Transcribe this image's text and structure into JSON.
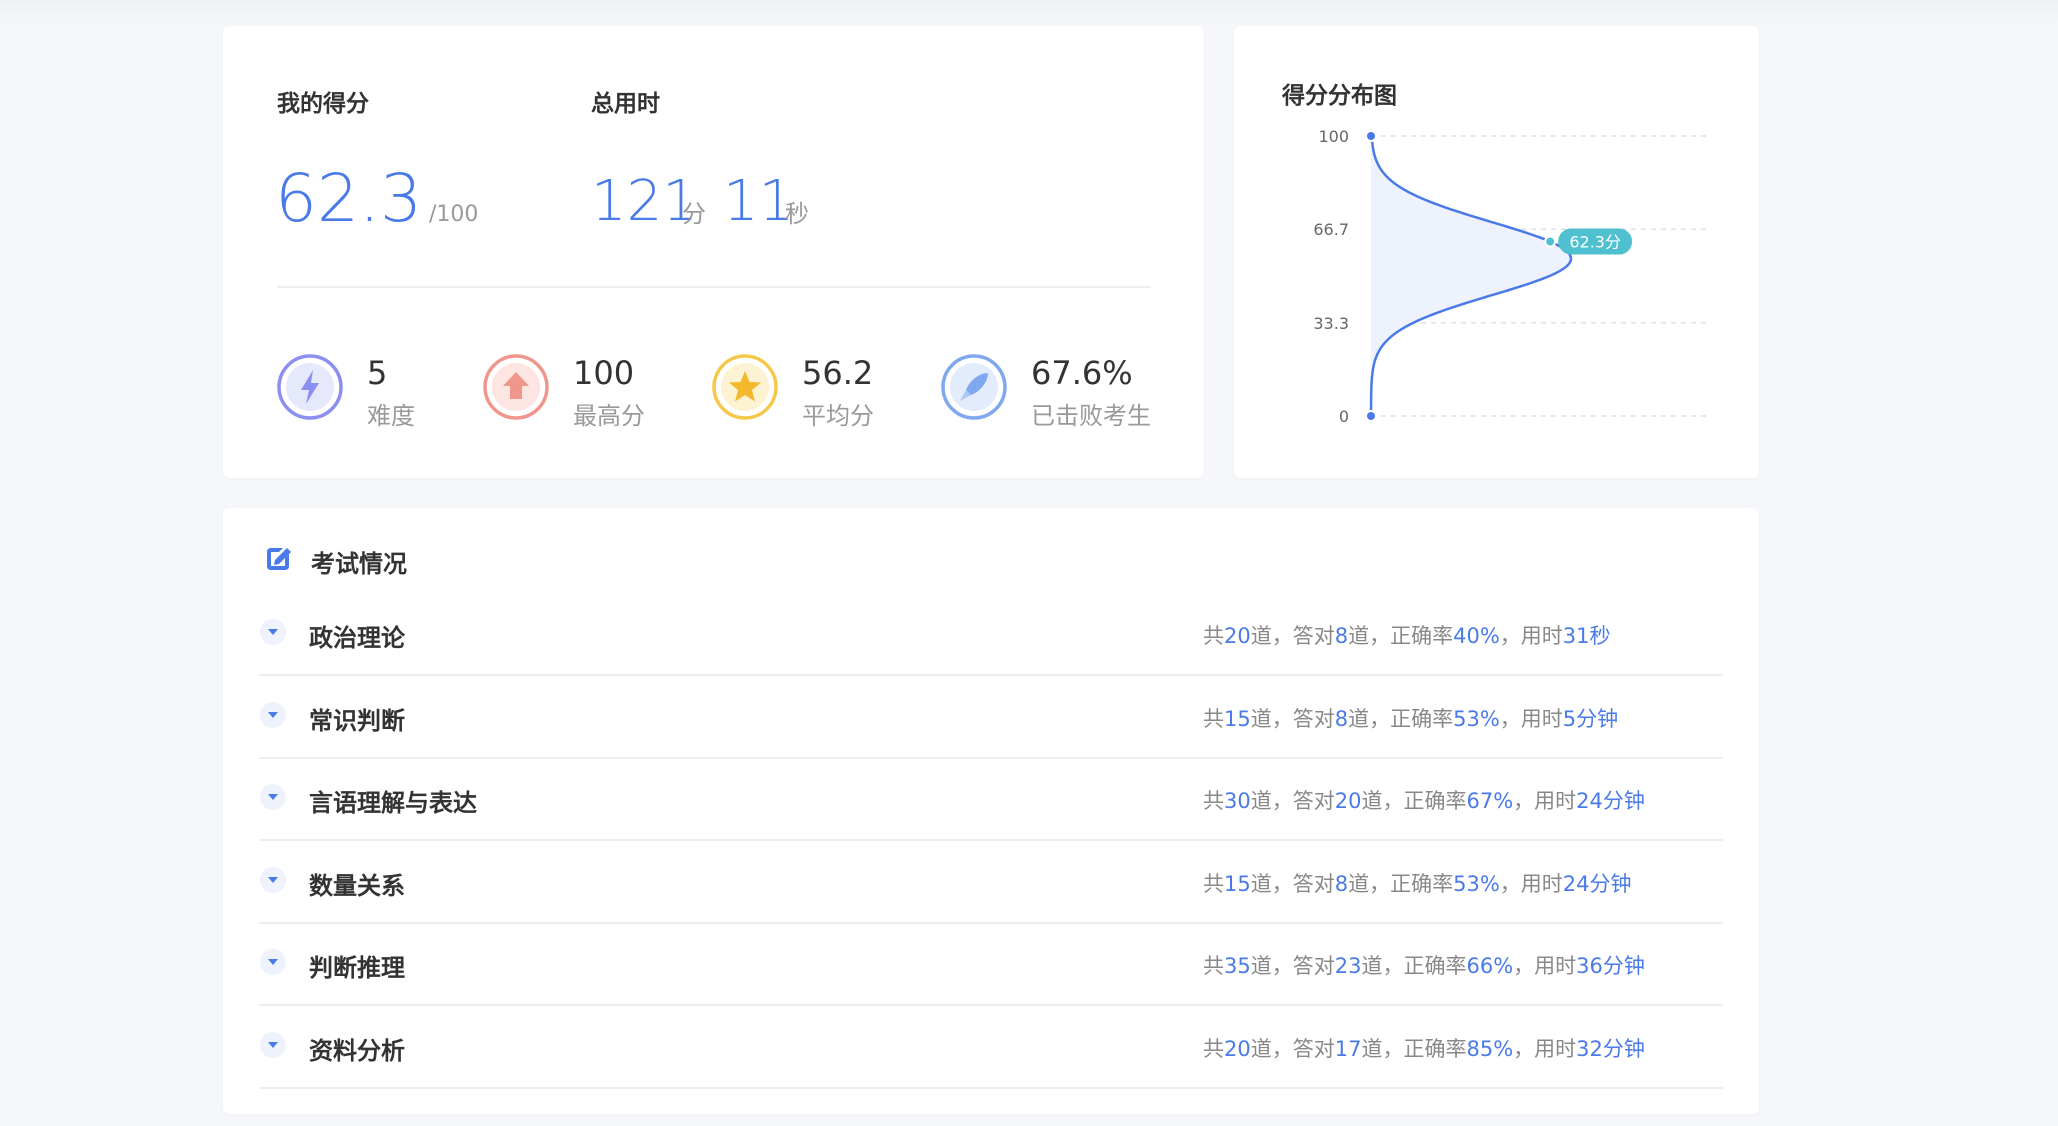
{
  "score_card": {
    "my_score_label": "我的得分",
    "my_score": "62.3",
    "my_score_total": "/100",
    "total_time_label": "总用时",
    "time_minutes": "121",
    "time_minutes_unit": "分",
    "time_seconds": "11",
    "time_seconds_unit": "秒",
    "stats": [
      {
        "value": "5",
        "label": "难度",
        "icon": "lightning-icon",
        "color": "#8b8ff0"
      },
      {
        "value": "100",
        "label": "最高分",
        "icon": "arrow-up-icon",
        "color": "#f0968d"
      },
      {
        "value": "56.2",
        "label": "平均分",
        "icon": "star-icon",
        "color": "#f5c84a"
      },
      {
        "value": "67.6%",
        "label": "已击败考生",
        "icon": "rocket-icon",
        "color": "#7fa8f0"
      }
    ]
  },
  "chart_card": {
    "title": "得分分布图",
    "marker_label": "62.3分"
  },
  "chart_data": {
    "type": "area",
    "title": "得分分布图",
    "y_ticks": [
      "100",
      "66.7",
      "33.3",
      "0"
    ],
    "ylim": [
      0,
      100
    ],
    "distribution_peak_score": 56.2,
    "marker": {
      "score": 62.3,
      "label": "62.3分"
    },
    "grid": true,
    "accent": "#4a7ae8",
    "fill": "#eef2fc",
    "marker_color": "#4fc0cf"
  },
  "exam": {
    "title": "考试情况",
    "subjects": [
      {
        "name": "政治理论",
        "p1": "共",
        "total": "20",
        "p2": "道，答对",
        "correct": "8",
        "p3": "道，正确率",
        "rate": "40%",
        "p4": "，用时",
        "time": "31秒"
      },
      {
        "name": "常识判断",
        "p1": "共",
        "total": "15",
        "p2": "道，答对",
        "correct": "8",
        "p3": "道，正确率",
        "rate": "53%",
        "p4": "，用时",
        "time": "5分钟"
      },
      {
        "name": "言语理解与表达",
        "p1": "共",
        "total": "30",
        "p2": "道，答对",
        "correct": "20",
        "p3": "道，正确率",
        "rate": "67%",
        "p4": "，用时",
        "time": "24分钟"
      },
      {
        "name": "数量关系",
        "p1": "共",
        "total": "15",
        "p2": "道，答对",
        "correct": "8",
        "p3": "道，正确率",
        "rate": "53%",
        "p4": "，用时",
        "time": "24分钟"
      },
      {
        "name": "判断推理",
        "p1": "共",
        "total": "35",
        "p2": "道，答对",
        "correct": "23",
        "p3": "道，正确率",
        "rate": "66%",
        "p4": "，用时",
        "time": "36分钟"
      },
      {
        "name": "资料分析",
        "p1": "共",
        "total": "20",
        "p2": "道，答对",
        "correct": "17",
        "p3": "道，正确率",
        "rate": "85%",
        "p4": "，用时",
        "time": "32分钟"
      }
    ]
  }
}
